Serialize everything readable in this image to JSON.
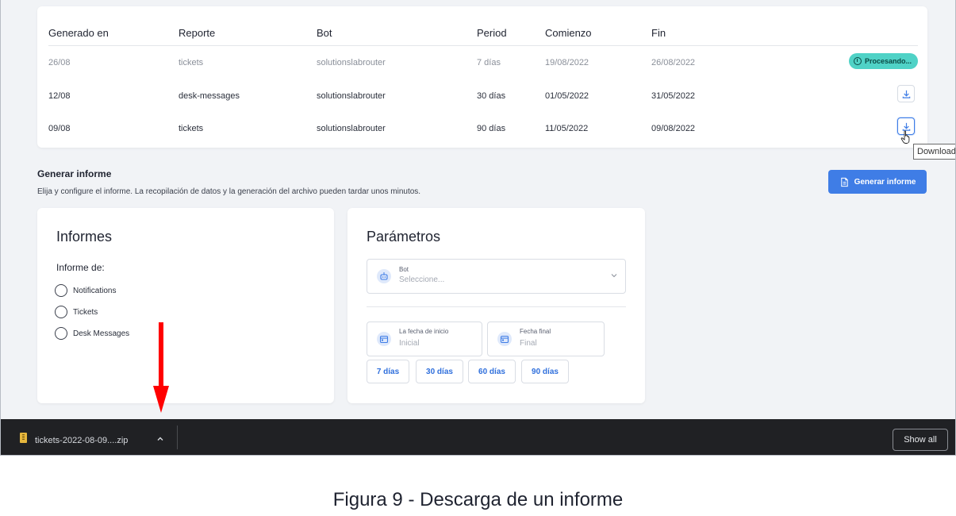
{
  "table": {
    "headers": [
      "Generado en",
      "Reporte",
      "Bot",
      "Period",
      "Comienzo",
      "Fin"
    ],
    "rows": [
      {
        "generado": "26/08",
        "reporte": "tickets",
        "bot": "solutionslabrouter",
        "period": "7 días",
        "comienzo": "19/08/2022",
        "fin": "26/08/2022",
        "status": "Procesando..."
      },
      {
        "generado": "12/08",
        "reporte": "desk-messages",
        "bot": "solutionslabrouter",
        "period": "30 días",
        "comienzo": "01/05/2022",
        "fin": "31/05/2022"
      },
      {
        "generado": "09/08",
        "reporte": "tickets",
        "bot": "solutionslabrouter",
        "period": "90 días",
        "comienzo": "11/05/2022",
        "fin": "09/08/2022"
      }
    ],
    "tooltip": "Download"
  },
  "generar": {
    "title": "Generar informe",
    "description": "Elija y configure el informe. La recopilación de datos y la generación del archivo pueden tardar unos minutos.",
    "button_label": "Generar informe"
  },
  "informes": {
    "title": "Informes",
    "subtitle": "Informe de:",
    "options": [
      "Notifications",
      "Tickets",
      "Desk Messages"
    ]
  },
  "parametros": {
    "title": "Parámetros",
    "bot_label": "Bot",
    "bot_placeholder": "Seleccione...",
    "start_label": "La fecha de inicio",
    "start_placeholder": "Inicial",
    "end_label": "Fecha final",
    "end_placeholder": "Final",
    "chips": [
      "7 días",
      "30 días",
      "60 días",
      "90 días"
    ]
  },
  "download_bar": {
    "filename": "tickets-2022-08-09....zip",
    "show_all": "Show all"
  },
  "caption": "Figura 9 - Descarga de un informe",
  "colors": {
    "accent": "#3f7de6",
    "badge": "#4fd2c6",
    "download_bar": "#202124",
    "annotation_arrow": "#ff0000"
  }
}
